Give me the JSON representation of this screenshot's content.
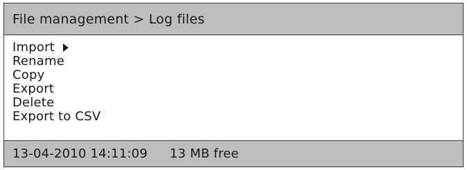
{
  "header": {
    "breadcrumb": "File management > Log files"
  },
  "menu": {
    "items": [
      {
        "label": "Import",
        "has_submenu": true,
        "submenu_icon": "triangle-right-icon"
      },
      {
        "label": "Rename"
      },
      {
        "label": "Copy"
      },
      {
        "label": "Export"
      },
      {
        "label": "Delete"
      },
      {
        "label": "Export to CSV"
      }
    ]
  },
  "status": {
    "datetime": "13-04-2010 14:11:09",
    "free_space": "13 MB free"
  },
  "colors": {
    "bar_background": "#bdbdbd",
    "text": "#1a1a1a",
    "border": "#3a3a3a"
  }
}
